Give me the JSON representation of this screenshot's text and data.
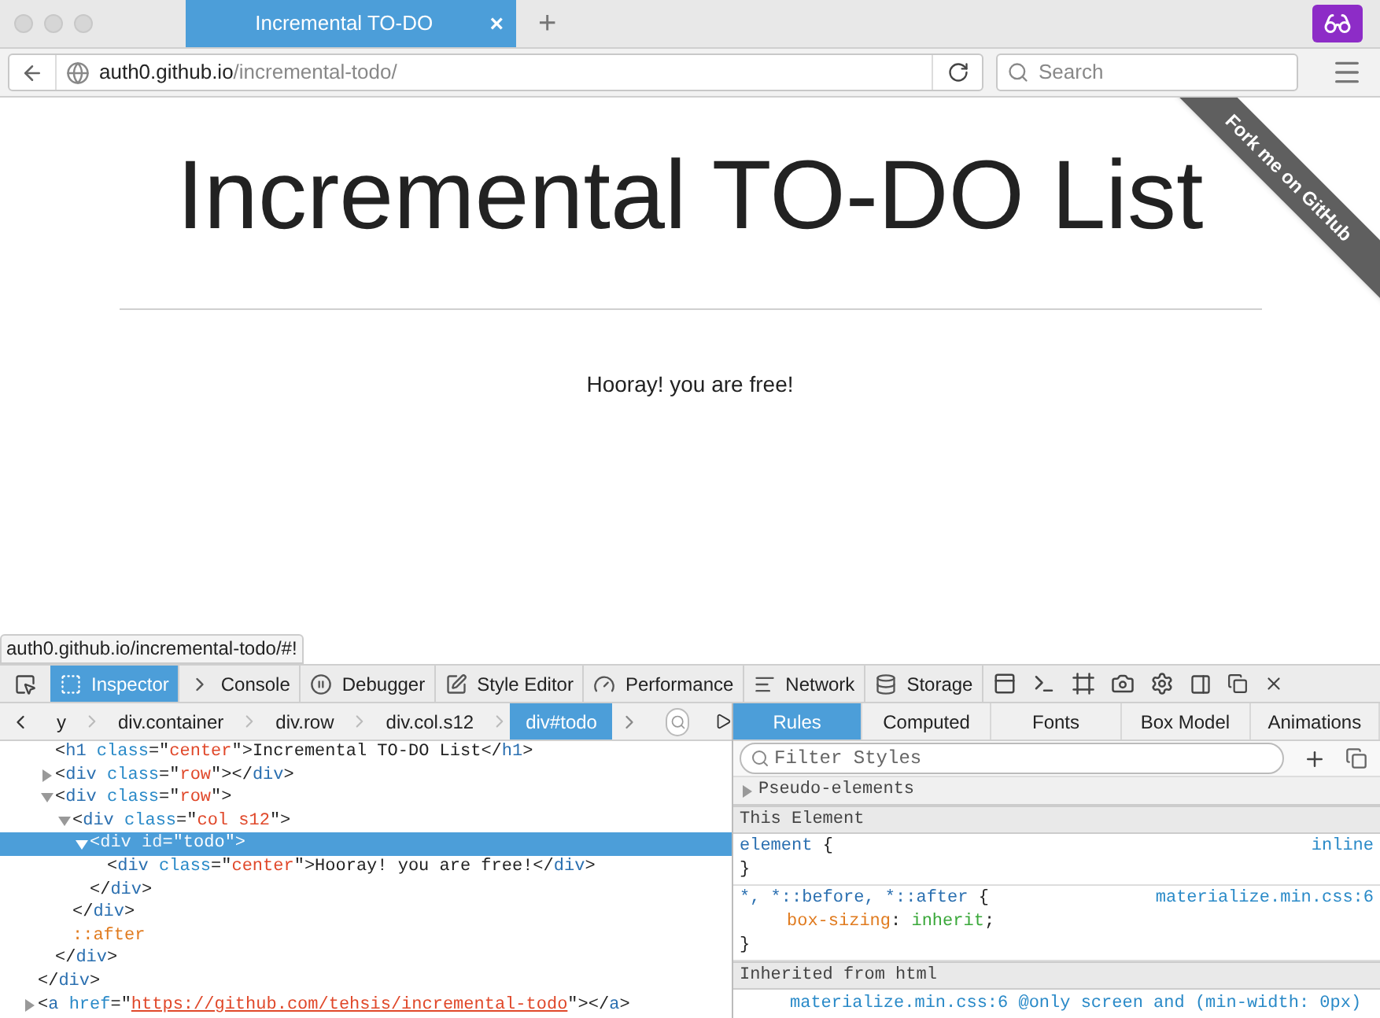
{
  "browser": {
    "tab": {
      "label": "Incremental TO-DO",
      "selected": true,
      "close": "×"
    },
    "new_tab": "+",
    "url_host": "auth0.github.io",
    "url_path": "/incremental-todo/",
    "search": {
      "placeholder": "Search"
    }
  },
  "page": {
    "title": "Incremental TO-DO List",
    "message": "Hooray! you are free!",
    "ribbon": "Fork me on GitHub",
    "status_url": "auth0.github.io/incremental-todo/#!"
  },
  "devtools": {
    "tabs": [
      {
        "label": "Inspector",
        "selected": true
      },
      {
        "label": "Console",
        "selected": false
      },
      {
        "label": "Debugger",
        "selected": false
      },
      {
        "label": "Style Editor",
        "selected": false
      },
      {
        "label": "Performance",
        "selected": false
      },
      {
        "label": "Network",
        "selected": false
      },
      {
        "label": "Storage",
        "selected": false
      }
    ],
    "breadcrumbs": [
      {
        "label": "y",
        "selected": false
      },
      {
        "label": "div.container",
        "selected": false
      },
      {
        "label": "div.row",
        "selected": false
      },
      {
        "label": "div.col.s12",
        "selected": false
      },
      {
        "label": "div#todo",
        "selected": true
      }
    ],
    "markup": [
      {
        "close": [
          {
            "kind": "bracket",
            "text": "</"
          },
          {
            "kind": "name",
            "text": "div"
          },
          {
            "kind": "bracket",
            "text": ">"
          }
        ],
        "children": [
          {
            "selected": false,
            "open": [
              {
                "kind": "bracket",
                "text": "<"
              },
              {
                "kind": "name",
                "text": "h1 "
              },
              {
                "kind": "attr",
                "text": "class"
              },
              {
                "kind": "bracket",
                "text": "=\""
              },
              {
                "kind": "value",
                "text": "center"
              },
              {
                "kind": "bracket",
                "text": "\">"
              },
              {
                "kind": "text",
                "text": "Incremental TO-DO List"
              },
              {
                "kind": "bracket",
                "text": "</"
              },
              {
                "kind": "name",
                "text": "h1"
              },
              {
                "kind": "bracket",
                "text": ">"
              }
            ]
          },
          {
            "expanded": false,
            "selected": false,
            "open": [
              {
                "kind": "bracket",
                "text": "<"
              },
              {
                "kind": "name",
                "text": "div "
              },
              {
                "kind": "attr",
                "text": "class"
              },
              {
                "kind": "bracket",
                "text": "=\""
              },
              {
                "kind": "value",
                "text": "row"
              },
              {
                "kind": "bracket",
                "text": "\"></"
              },
              {
                "kind": "name",
                "text": "div"
              },
              {
                "kind": "bracket",
                "text": ">"
              }
            ]
          },
          {
            "expanded": true,
            "selected": false,
            "open": [
              {
                "kind": "bracket",
                "text": "<"
              },
              {
                "kind": "name",
                "text": "div "
              },
              {
                "kind": "attr",
                "text": "class"
              },
              {
                "kind": "bracket",
                "text": "=\""
              },
              {
                "kind": "value",
                "text": "row"
              },
              {
                "kind": "bracket",
                "text": "\">"
              }
            ],
            "close": [
              {
                "kind": "bracket",
                "text": "</"
              },
              {
                "kind": "name",
                "text": "div"
              },
              {
                "kind": "bracket",
                "text": ">"
              }
            ],
            "children": [
              {
                "expanded": true,
                "selected": false,
                "open": [
                  {
                    "kind": "bracket",
                    "text": "<"
                  },
                  {
                    "kind": "name",
                    "text": "div "
                  },
                  {
                    "kind": "attr",
                    "text": "class"
                  },
                  {
                    "kind": "bracket",
                    "text": "=\""
                  },
                  {
                    "kind": "value",
                    "text": "col s12"
                  },
                  {
                    "kind": "bracket",
                    "text": "\">"
                  }
                ],
                "close": [
                  {
                    "kind": "bracket",
                    "text": "</"
                  },
                  {
                    "kind": "name",
                    "text": "div"
                  },
                  {
                    "kind": "bracket",
                    "text": ">"
                  }
                ],
                "children": [
                  {
                    "expanded": true,
                    "selected": true,
                    "open": [
                      {
                        "kind": "bracket",
                        "text": "<"
                      },
                      {
                        "kind": "name",
                        "text": "div "
                      },
                      {
                        "kind": "attr",
                        "text": "id"
                      },
                      {
                        "kind": "bracket",
                        "text": "=\""
                      },
                      {
                        "kind": "value",
                        "text": "todo"
                      },
                      {
                        "kind": "bracket",
                        "text": "\">"
                      }
                    ],
                    "close": [
                      {
                        "kind": "bracket",
                        "text": "</"
                      },
                      {
                        "kind": "name",
                        "text": "div"
                      },
                      {
                        "kind": "bracket",
                        "text": ">"
                      }
                    ],
                    "children": [
                      {
                        "selected": false,
                        "open": [
                          {
                            "kind": "bracket",
                            "text": "<"
                          },
                          {
                            "kind": "name",
                            "text": "div "
                          },
                          {
                            "kind": "attr",
                            "text": "class"
                          },
                          {
                            "kind": "bracket",
                            "text": "=\""
                          },
                          {
                            "kind": "value",
                            "text": "center"
                          },
                          {
                            "kind": "bracket",
                            "text": "\">"
                          },
                          {
                            "kind": "text",
                            "text": "Hooray! you are free!"
                          },
                          {
                            "kind": "bracket",
                            "text": "</"
                          },
                          {
                            "kind": "name",
                            "text": "div"
                          },
                          {
                            "kind": "bracket",
                            "text": ">"
                          }
                        ]
                      }
                    ]
                  }
                ]
              },
              {
                "selected": false,
                "open": [
                  {
                    "kind": "pseudo",
                    "text": "::after"
                  }
                ]
              }
            ]
          }
        ]
      },
      {
        "expanded": false,
        "selected": false,
        "open": [
          {
            "kind": "bracket",
            "text": "<"
          },
          {
            "kind": "name",
            "text": "a "
          },
          {
            "kind": "attr",
            "text": "href"
          },
          {
            "kind": "bracket",
            "text": "=\""
          },
          {
            "kind": "link",
            "text": "https://github.com/tehsis/incremental-todo"
          },
          {
            "kind": "bracket",
            "text": "\"></"
          },
          {
            "kind": "name",
            "text": "a"
          },
          {
            "kind": "bracket",
            "text": ">"
          }
        ]
      }
    ],
    "side_tabs": [
      {
        "label": "Rules",
        "selected": true
      },
      {
        "label": "Computed",
        "selected": false
      },
      {
        "label": "Fonts",
        "selected": false
      },
      {
        "label": "Box Model",
        "selected": false
      },
      {
        "label": "Animations",
        "selected": false
      }
    ],
    "filter": {
      "placeholder": "Filter Styles"
    },
    "rules": [
      {
        "kind": "collapsed",
        "text": "Pseudo-elements"
      },
      {
        "kind": "header",
        "text": "This Element"
      },
      {
        "kind": "rule",
        "selector": "element",
        "open_brace": "{",
        "source": "inline",
        "close_brace": "}"
      },
      {
        "kind": "rule",
        "selector": "*, *::before, *::after",
        "open_brace": "{",
        "source": "materialize.min.css:6",
        "declarations": [
          {
            "property": "box-sizing",
            "colon": ":",
            "value": "inherit",
            "semicolon": ";"
          }
        ],
        "close_brace": "}"
      },
      {
        "kind": "header",
        "text": "Inherited from html"
      },
      {
        "kind": "source",
        "text": "materialize.min.css:6 @only screen and (min-width: 0px)"
      }
    ]
  }
}
